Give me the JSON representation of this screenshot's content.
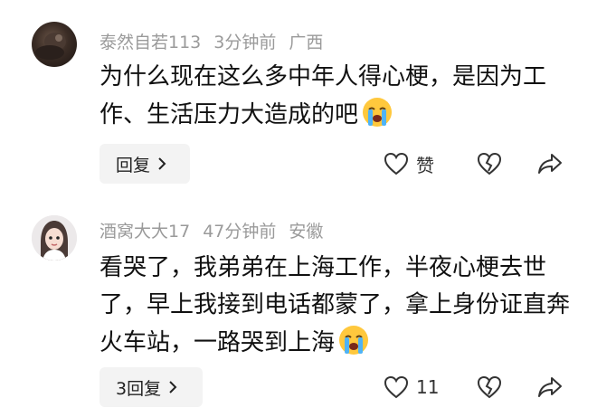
{
  "comments": [
    {
      "username": "泰然自若113",
      "time": "3分钟前",
      "location": "广西",
      "text": "为什么现在这么多中年人得心梗，是因为工作、生活压力大造成的吧",
      "emoji": "crying-face",
      "reply_label": "回复",
      "like_label": "赞"
    },
    {
      "username": "酒窝大大17",
      "time": "47分钟前",
      "location": "安徽",
      "text": "看哭了，我弟弟在上海工作，半夜心梗去世了，早上我接到电话都蒙了，拿上身份证直奔火车站，一路哭到上海",
      "emoji": "crying-face",
      "reply_label": "3回复",
      "like_label": "11"
    }
  ],
  "colors": {
    "meta_text": "#9a9a9a",
    "body_text": "#111111",
    "button_bg": "#f3f3f3",
    "icon_stroke": "#333333"
  },
  "icons": {
    "like": "heart-outline-icon",
    "dislike": "broken-heart-icon",
    "share": "share-arrow-icon",
    "reply_chevron": "chevron-right-icon"
  }
}
